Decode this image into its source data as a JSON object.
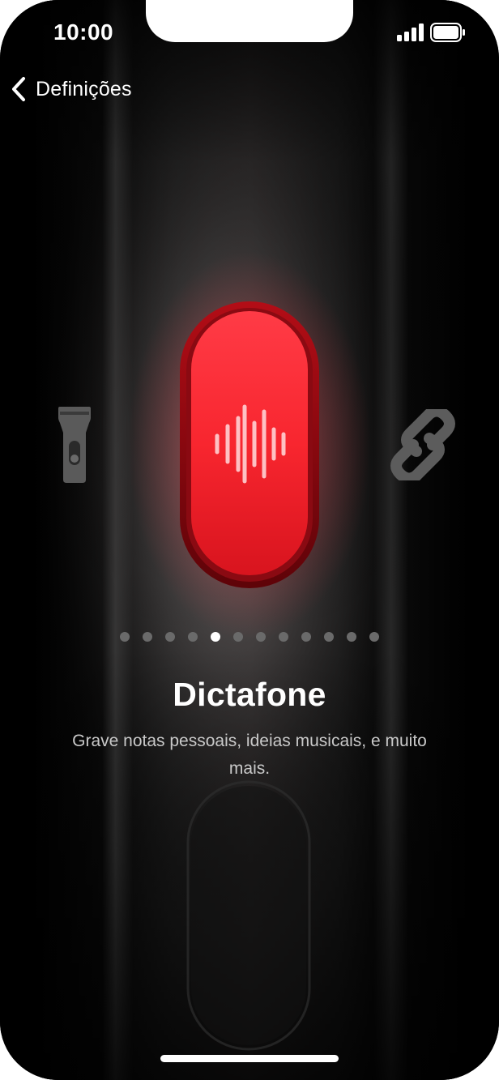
{
  "status_bar": {
    "time": "10:00"
  },
  "nav": {
    "back_label": "Definições"
  },
  "carousel": {
    "page_count": 12,
    "current_index": 4,
    "left_icon": "flashlight-icon",
    "center_icon": "waveform-icon",
    "right_icon": "shazam-icon"
  },
  "content": {
    "title": "Dictafone",
    "description": "Grave notas pessoais, ideias musicais, e muito mais."
  },
  "colors": {
    "background": "#000000",
    "action_button_red": "#ff2d3a",
    "text_primary": "#ffffff",
    "text_secondary": "#c9c9c9"
  }
}
